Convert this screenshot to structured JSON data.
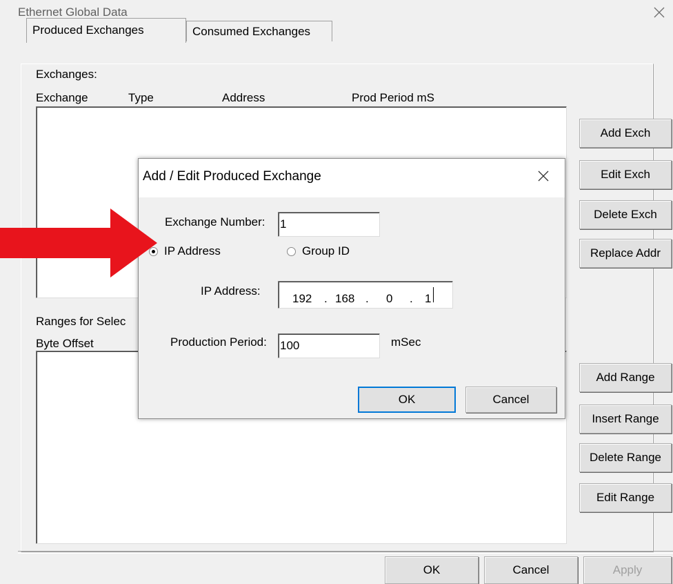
{
  "window": {
    "title": "Ethernet Global Data"
  },
  "tabs": [
    {
      "label": "Produced Exchanges",
      "active": true
    },
    {
      "label": "Consumed Exchanges",
      "active": false
    }
  ],
  "exchanges": {
    "label": "Exchanges:",
    "columns": [
      "Exchange",
      "Type",
      "Address",
      "Prod Period mS"
    ]
  },
  "ranges": {
    "label": "Ranges for Selec",
    "columns": [
      "Byte Offset"
    ]
  },
  "side_buttons": {
    "add_exch": "Add Exch",
    "edit_exch": "Edit Exch",
    "delete_exch": "Delete Exch",
    "replace_addr": "Replace Addr",
    "add_range": "Add Range",
    "insert_range": "Insert Range",
    "delete_range": "Delete Range",
    "edit_range": "Edit Range"
  },
  "bottom_buttons": {
    "ok": "OK",
    "cancel": "Cancel",
    "apply": "Apply"
  },
  "dialog": {
    "title": "Add / Edit Produced Exchange",
    "exchange_number_label": "Exchange Number:",
    "exchange_number_value": "1",
    "radio_ip_label": "IP Address",
    "radio_group_label": "Group ID",
    "selected_radio": "IP Address",
    "ip_label": "IP Address:",
    "ip_octets": [
      "192",
      "168",
      "0",
      "1"
    ],
    "production_period_label": "Production Period:",
    "production_period_value": "100",
    "production_period_unit": "mSec",
    "ok": "OK",
    "cancel": "Cancel"
  },
  "colors": {
    "arrow": "#e8141c",
    "apply_disabled_text": "#a0a0a0"
  },
  "icons": [
    "close-icon",
    "radio-selected-icon",
    "radio-unselected-icon",
    "red-arrow-icon"
  ]
}
